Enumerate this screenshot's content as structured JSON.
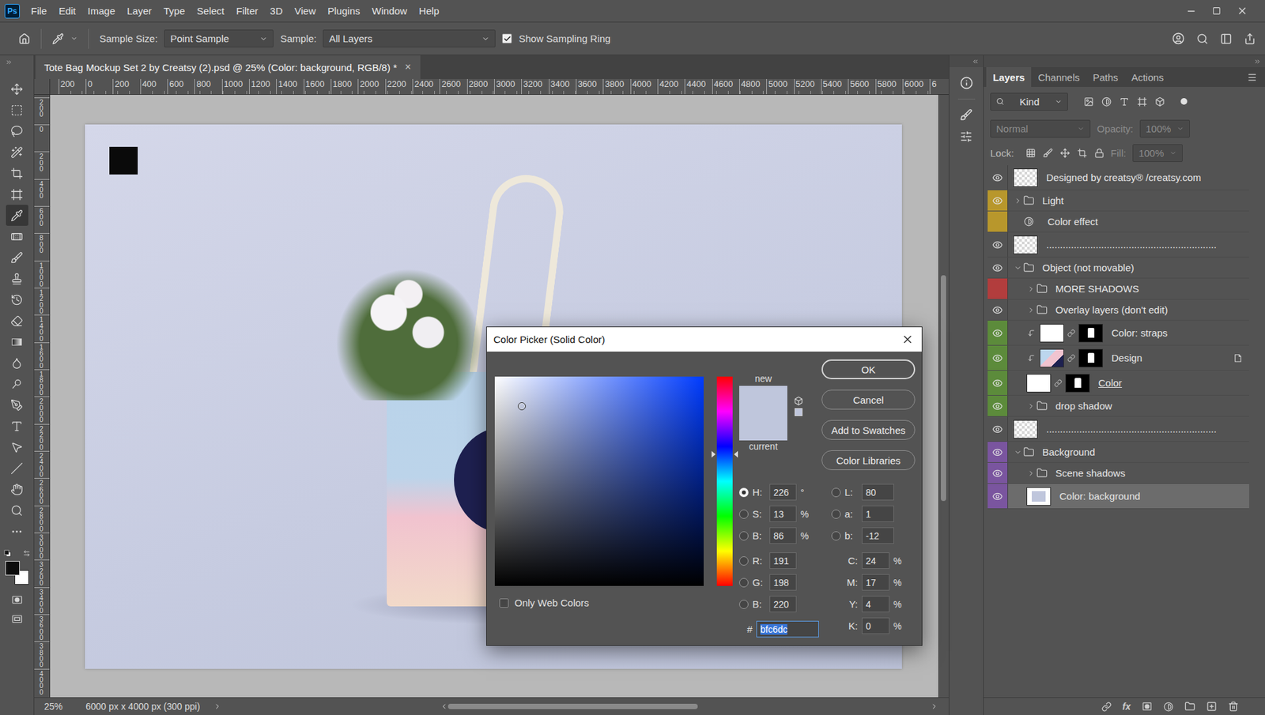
{
  "app": {
    "logo": "Ps"
  },
  "menu": [
    "File",
    "Edit",
    "Image",
    "Layer",
    "Type",
    "Select",
    "Filter",
    "3D",
    "View",
    "Plugins",
    "Window",
    "Help"
  ],
  "options_bar": {
    "sample_size": {
      "label": "Sample Size:",
      "value": "Point Sample"
    },
    "sample": {
      "label": "Sample:",
      "value": "All Layers"
    },
    "sampling_ring": {
      "label": "Show Sampling Ring",
      "checked": true
    }
  },
  "document": {
    "tab": {
      "title": "Tote Bag Mockup Set 2 by Creatsy (2).psd @ 25% (Color: background, RGB/8) *",
      "close": "×",
      "selected": true
    },
    "ruler_h": [
      "200",
      "0",
      "200",
      "400",
      "600",
      "800",
      "1000",
      "1200",
      "1400",
      "1600",
      "1800",
      "2000",
      "2200",
      "2400",
      "2600",
      "2800",
      "3000",
      "3200",
      "3400",
      "3600",
      "3800",
      "4000",
      "4200",
      "4400",
      "4600",
      "4800",
      "5000",
      "5200",
      "5400",
      "5600",
      "5800",
      "6000",
      "6"
    ],
    "ruler_v": [
      "200",
      "0",
      "200",
      "400",
      "600",
      "800",
      "1000",
      "1200",
      "1400",
      "1600",
      "1800",
      "2000",
      "2200",
      "2400",
      "2600",
      "2800",
      "3000",
      "3200",
      "3400",
      "3600",
      "3800",
      "4000"
    ]
  },
  "status_bar": {
    "zoom": "25%",
    "info": "6000 px x 4000 px (300 ppi)"
  },
  "tools": [
    {
      "kind": "move",
      "selected": false
    },
    {
      "kind": "marquee",
      "selected": false
    },
    {
      "kind": "lasso",
      "selected": false
    },
    {
      "kind": "quick-select",
      "selected": false
    },
    {
      "kind": "crop",
      "selected": false
    },
    {
      "kind": "frame",
      "selected": false
    },
    {
      "kind": "eyedropper",
      "selected": true
    },
    {
      "kind": "healing",
      "selected": false
    },
    {
      "kind": "brush",
      "selected": false
    },
    {
      "kind": "stamp",
      "selected": false
    },
    {
      "kind": "history-brush",
      "selected": false
    },
    {
      "kind": "eraser",
      "selected": false
    },
    {
      "kind": "gradient",
      "selected": false
    },
    {
      "kind": "blur",
      "selected": false
    },
    {
      "kind": "dodge",
      "selected": false
    },
    {
      "kind": "pen",
      "selected": false
    },
    {
      "kind": "type",
      "selected": false
    },
    {
      "kind": "path-select",
      "selected": false
    },
    {
      "kind": "line",
      "selected": false
    },
    {
      "kind": "hand",
      "selected": false
    },
    {
      "kind": "zoom",
      "selected": false
    },
    {
      "kind": "more",
      "selected": false
    }
  ],
  "swatches": {
    "foreground": "#0d0d0d",
    "background": "#ffffff"
  },
  "layers_panel": {
    "tabs": [
      {
        "label": "Layers",
        "selected": true
      },
      {
        "label": "Channels",
        "selected": false
      },
      {
        "label": "Paths",
        "selected": false
      },
      {
        "label": "Actions",
        "selected": false
      }
    ],
    "filter": {
      "value": "Kind"
    },
    "blend_mode": {
      "value": "Normal",
      "disabled": true
    },
    "opacity": {
      "label": "Opacity:",
      "value": "100%",
      "disabled": true
    },
    "lock": {
      "label": "Lock:"
    },
    "fill": {
      "label": "Fill:",
      "value": "100%",
      "disabled": true
    },
    "layers": [
      {
        "name": "Designed by creatsy® /creatsy.com",
        "kind": "pixel",
        "depth": 0,
        "visible": true,
        "color": null,
        "expanded": false,
        "clipped": false,
        "mask": false,
        "selected": false,
        "underlined": false,
        "thumb": null
      },
      {
        "name": "Light",
        "kind": "folder",
        "depth": 0,
        "visible": true,
        "color": "#b8972c",
        "expanded": false,
        "clipped": false,
        "mask": false,
        "selected": false,
        "underlined": false,
        "thumb": null
      },
      {
        "name": "Color effect",
        "kind": "adjustment",
        "depth": 0,
        "visible": false,
        "color": "#b8972c",
        "expanded": false,
        "clipped": false,
        "mask": false,
        "selected": false,
        "underlined": false,
        "thumb": null
      },
      {
        "name": "..............................................................",
        "kind": "pixel",
        "depth": 0,
        "visible": true,
        "color": null,
        "expanded": false,
        "clipped": false,
        "mask": false,
        "selected": false,
        "underlined": false,
        "thumb": null
      },
      {
        "name": "Object (not movable)",
        "kind": "folder",
        "depth": 0,
        "visible": true,
        "color": null,
        "expanded": true,
        "clipped": false,
        "mask": false,
        "selected": false,
        "underlined": false,
        "thumb": null
      },
      {
        "name": "MORE SHADOWS",
        "kind": "folder",
        "depth": 1,
        "visible": false,
        "color": "#b23d3d",
        "expanded": false,
        "clipped": false,
        "mask": false,
        "selected": false,
        "underlined": false,
        "thumb": null
      },
      {
        "name": "Overlay layers (don't edit)",
        "kind": "folder",
        "depth": 1,
        "visible": true,
        "color": null,
        "expanded": false,
        "clipped": false,
        "mask": false,
        "selected": false,
        "underlined": false,
        "thumb": null
      },
      {
        "name": "Color: straps",
        "kind": "fill",
        "depth": 1,
        "visible": true,
        "color": "#5c8b3b",
        "expanded": false,
        "clipped": true,
        "mask": true,
        "selected": false,
        "underlined": false,
        "thumb": "#ffffff"
      },
      {
        "name": "Design",
        "kind": "smart",
        "depth": 1,
        "visible": true,
        "color": "#5c8b3b",
        "expanded": false,
        "clipped": true,
        "mask": true,
        "selected": false,
        "underlined": false,
        "thumb": null
      },
      {
        "name": "Color",
        "kind": "fill",
        "depth": 1,
        "visible": true,
        "color": "#5c8b3b",
        "expanded": false,
        "clipped": false,
        "mask": true,
        "selected": false,
        "underlined": true,
        "thumb": "#ffffff"
      },
      {
        "name": "drop shadow",
        "kind": "folder",
        "depth": 1,
        "visible": true,
        "color": "#5c8b3b",
        "expanded": false,
        "clipped": false,
        "mask": false,
        "selected": false,
        "underlined": false,
        "thumb": null
      },
      {
        "name": "..............................................................",
        "kind": "pixel",
        "depth": 0,
        "visible": true,
        "color": null,
        "expanded": false,
        "clipped": false,
        "mask": false,
        "selected": false,
        "underlined": false,
        "thumb": null
      },
      {
        "name": "Background",
        "kind": "folder",
        "depth": 0,
        "visible": true,
        "color": "#7a559f",
        "expanded": true,
        "clipped": false,
        "mask": false,
        "selected": false,
        "underlined": false,
        "thumb": null
      },
      {
        "name": "Scene shadows",
        "kind": "folder",
        "depth": 1,
        "visible": true,
        "color": "#7a559f",
        "expanded": false,
        "clipped": false,
        "mask": false,
        "selected": false,
        "underlined": false,
        "thumb": null
      },
      {
        "name": "Color: background",
        "kind": "fill",
        "depth": 1,
        "visible": true,
        "color": "#7a559f",
        "expanded": false,
        "clipped": false,
        "mask": false,
        "selected": true,
        "underlined": false,
        "thumb": "#bfc6dc"
      }
    ],
    "footer_fx": "fx"
  },
  "color_picker": {
    "title": "Color Picker (Solid Color)",
    "new_label": "new",
    "current_label": "current",
    "current_color": "#bfc6dc",
    "buttons": [
      {
        "label": "OK",
        "default": true
      },
      {
        "label": "Cancel",
        "default": false
      },
      {
        "label": "Add to Swatches",
        "default": false
      },
      {
        "label": "Color Libraries",
        "default": false
      }
    ],
    "only_web_colors": {
      "label": "Only Web Colors",
      "checked": false
    },
    "hsb": [
      {
        "label": "H:",
        "value": "226",
        "unit": "°",
        "selected": true
      },
      {
        "label": "S:",
        "value": "13",
        "unit": "%",
        "selected": false
      },
      {
        "label": "B:",
        "value": "86",
        "unit": "%",
        "selected": false
      }
    ],
    "rgb": [
      {
        "label": "R:",
        "value": "191",
        "selected": false
      },
      {
        "label": "G:",
        "value": "198",
        "selected": false
      },
      {
        "label": "B:",
        "value": "220",
        "selected": false
      }
    ],
    "lab": [
      {
        "label": "L:",
        "value": "80",
        "selected": false
      },
      {
        "label": "a:",
        "value": "1",
        "selected": false
      },
      {
        "label": "b:",
        "value": "-12",
        "selected": false
      }
    ],
    "cmyk": [
      {
        "label": "C:",
        "value": "24",
        "unit": "%"
      },
      {
        "label": "M:",
        "value": "17",
        "unit": "%"
      },
      {
        "label": "Y:",
        "value": "4",
        "unit": "%"
      },
      {
        "label": "K:",
        "value": "0",
        "unit": "%"
      }
    ],
    "hex": {
      "label": "#",
      "value": "bfc6dc",
      "text_selected": true
    }
  }
}
